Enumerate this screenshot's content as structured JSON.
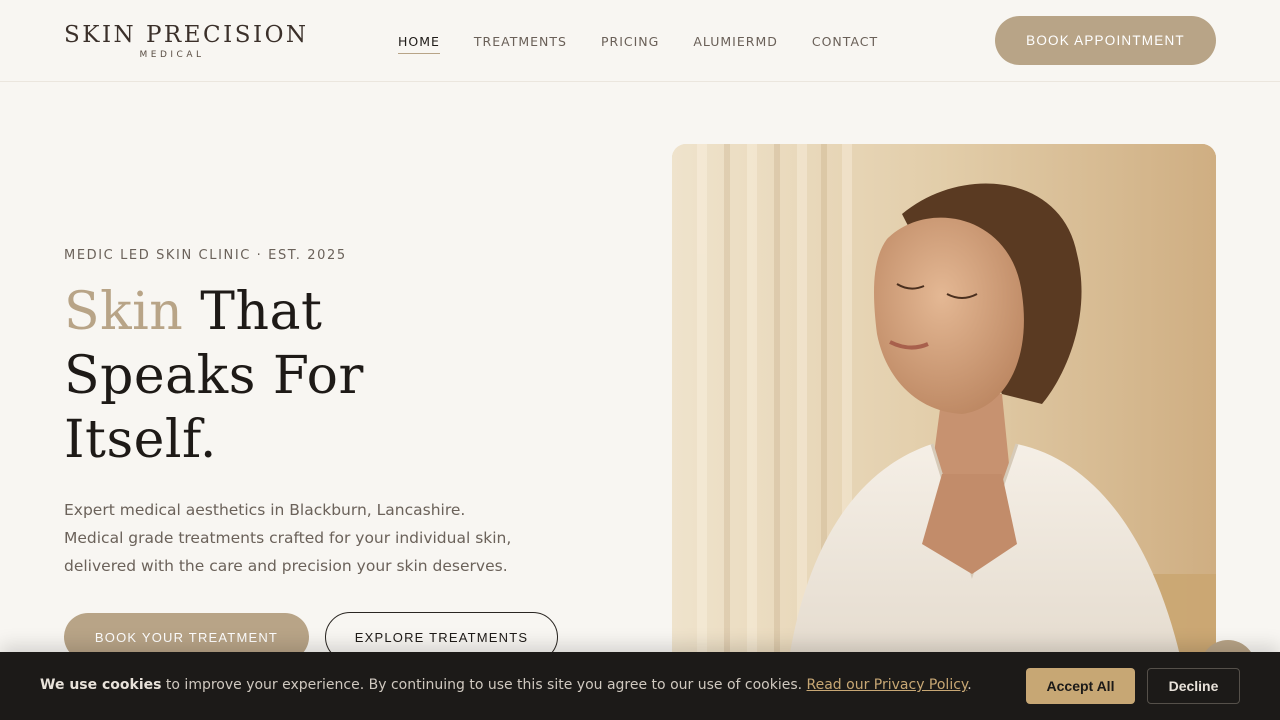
{
  "header": {
    "logo_main": "SKIN PRECISION",
    "logo_sub": "MEDICAL",
    "nav": [
      {
        "label": "HOME",
        "active": true
      },
      {
        "label": "TREATMENTS",
        "active": false
      },
      {
        "label": "PRICING",
        "active": false
      },
      {
        "label": "ALUMIERMD",
        "active": false
      },
      {
        "label": "CONTACT",
        "active": false
      }
    ],
    "book_button": "BOOK APPOINTMENT"
  },
  "hero": {
    "eyebrow": "MEDIC LED SKIN CLINIC · EST. 2025",
    "headline_accent": "Skin",
    "headline_rest": " That Speaks For Itself.",
    "description": "Expert medical aesthetics in Blackburn, Lancashire. Medical grade treatments crafted for your individual skin, delivered with the care and precision your skin deserves.",
    "primary_button": "BOOK YOUR TREATMENT",
    "secondary_button": "EXPLORE TREATMENTS"
  },
  "cookie": {
    "bold": "We use cookies",
    "text": " to improve your experience. By continuing to use this site you agree to our use of cookies. ",
    "link": "Read our Privacy Policy",
    "period": ".",
    "accept": "Accept All",
    "decline": "Decline"
  },
  "colors": {
    "background": "#f8f6f2",
    "accent": "#b8a487",
    "cookie_bg": "#1c1a18",
    "cookie_accent": "#c7a774"
  }
}
